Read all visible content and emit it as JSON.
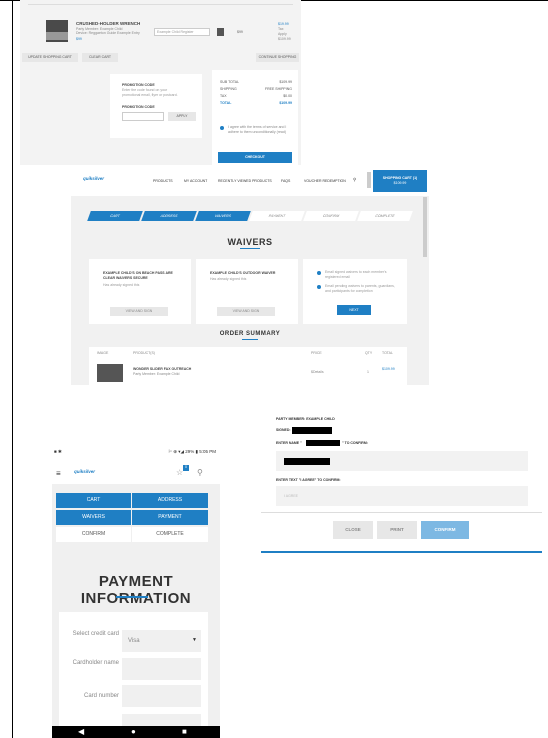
{
  "cart_panel": {
    "product_title": "CRUSHED-HOLDER WRENCH",
    "product_meta": [
      "Party Member: Example Child",
      "Device: Reggaeton Guide Example Entry",
      "$99"
    ],
    "select_placeholder": "Example Child Register",
    "price_label": "$99",
    "line_notes": [
      "$19.99",
      "Tax",
      "Apply",
      "$109.99"
    ],
    "update_label": "UPDATE SHOPPING CART",
    "clear_label": "CLEAR CART",
    "continue_label": "CONTINUE SHOPPING",
    "promo_title": "PROMOTION CODE",
    "promo_text": "Enter the code found on your promotional email, flyer or postcard.",
    "promo_field_label": "PROMOTION CODE",
    "apply_label": "APPLY",
    "summary": [
      {
        "label": "SUB TOTAL",
        "value": "$109.99"
      },
      {
        "label": "SHIPPING",
        "value": "FREE SHIPPING"
      },
      {
        "label": "TAX",
        "value": "$0.00"
      },
      {
        "label": "TOTAL",
        "value": "$109.99"
      }
    ],
    "agree_text": "I agree with the terms of service and I adhere to them unconditionally (read)",
    "checkout_label": "CHECKOUT"
  },
  "desktop_panel": {
    "logo": "quiksilver",
    "nav": [
      "PRODUCTS",
      "MY ACCOUNT",
      "RECENTLY VIEWED PRODUCTS",
      "FAQS",
      "VOUCHER REDEMPTION"
    ],
    "cart_button": [
      "SHOPPING CART (1)",
      "$109.99"
    ],
    "steps": [
      "CART",
      "ADDRESS",
      "WAIVERS",
      "PAYMENT",
      "CONFIRM",
      "COMPLETE"
    ],
    "title": "WAIVERS",
    "cards": [
      {
        "title": "EXAMPLE CHILD'S ON BEACH PASS ARE CLEAR WAIVERS SECURE",
        "sub": "Has already signed this",
        "button": "VIEW AND SIGN"
      },
      {
        "title": "EXAMPLE CHILD'S OUTDOOR WAIVER",
        "sub": "Has already signed this",
        "button": "VIEW AND SIGN"
      }
    ],
    "email_lines": [
      "Email signed waivers to each member's registered email",
      "Email pending waivers to parents, guardians, and participants for completion"
    ],
    "next_label": "NEXT",
    "order_title": "ORDER SUMMARY",
    "order_headers": [
      "IMAGE",
      "PRODUCT(S)",
      "PRICE",
      "QTY",
      "TOTAL"
    ],
    "order_row": {
      "name": "WONDER SLIDER FAX OUTREACH",
      "detail": "Party Member: Example Child",
      "price": "$Details",
      "qty": "1",
      "total": "$109.99"
    }
  },
  "waiver_panel": {
    "lines": [
      "PARTY MEMBER: EXAMPLE CHILD",
      "SIGNED:"
    ],
    "confirm_prefix": "ENTER NAME \"",
    "confirm_suffix": "\" TO CONFIRM:",
    "agree_prompt": "ENTER TEXT \"I AGREE\" TO CONFIRM:",
    "agree_placeholder": "I AGREE",
    "buttons": [
      "CLOSE",
      "PRINT",
      "CONFIRM"
    ]
  },
  "phone": {
    "status_left": "■ ✱",
    "status_right": "⚐ ⊕ ▾◢ 29% ▮ 5:05 PM",
    "logo": "quiksilver",
    "cart_count": "0",
    "steps": [
      "CART",
      "ADDRESS",
      "WAIVERS",
      "PAYMENT",
      "CONFIRM",
      "COMPLETE"
    ],
    "title": "PAYMENT INFORMATION",
    "form": [
      {
        "label": "Select credit card",
        "value": "Visa"
      },
      {
        "label": "Cardholder name",
        "value": ""
      },
      {
        "label": "Card number",
        "value": ""
      }
    ]
  }
}
